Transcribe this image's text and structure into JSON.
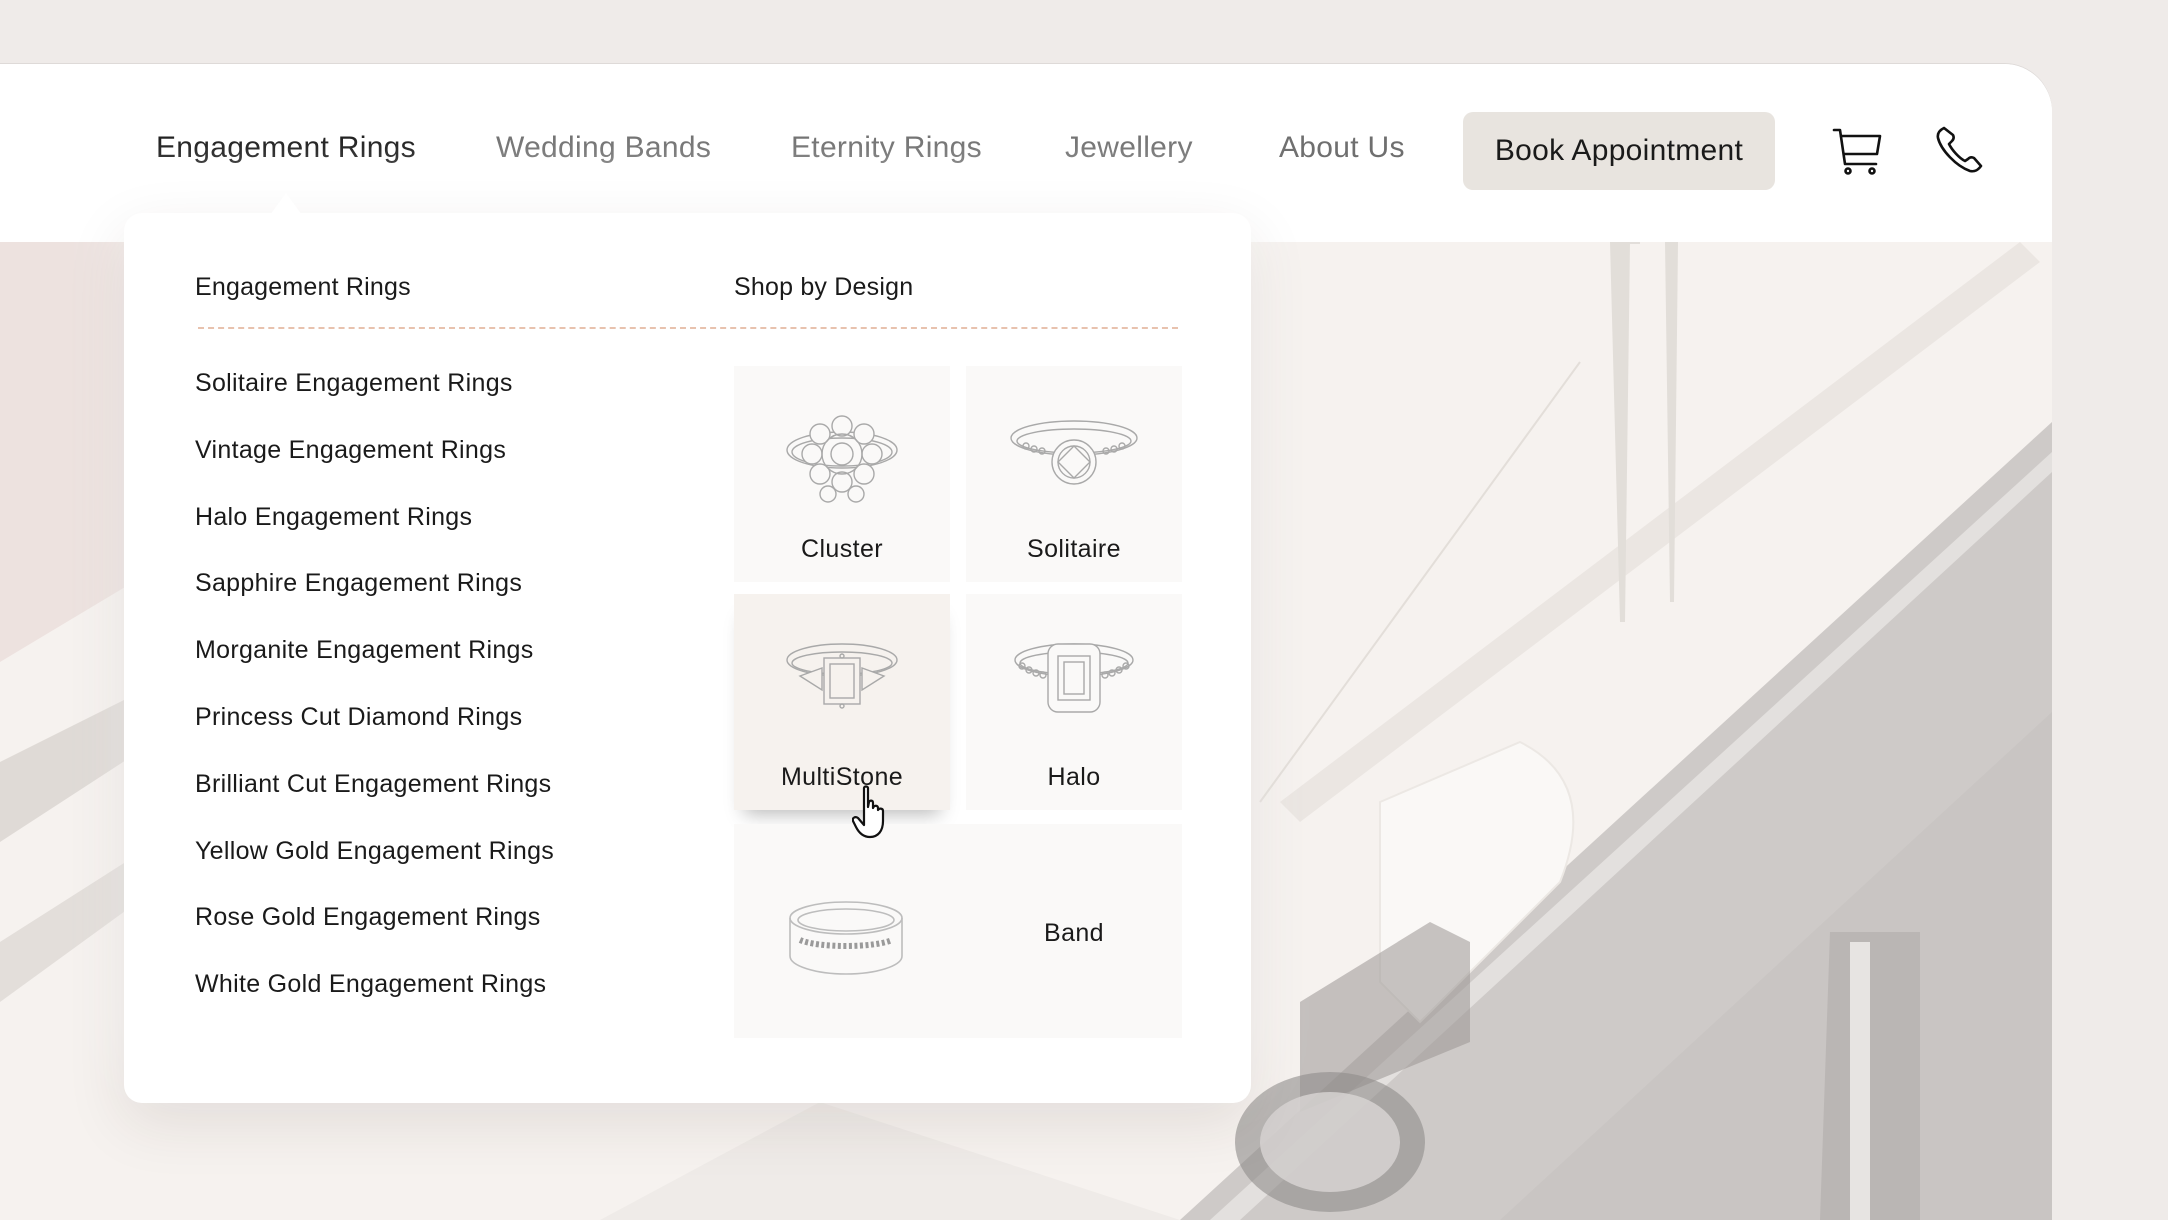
{
  "nav": {
    "items": [
      {
        "label": "Engagement Rings",
        "active": true
      },
      {
        "label": "Wedding Bands",
        "active": false
      },
      {
        "label": "Eternity Rings",
        "active": false
      },
      {
        "label": "Jewellery",
        "active": false
      },
      {
        "label": "About Us",
        "active": false
      }
    ],
    "book_button": "Book Appointment",
    "icons": [
      "cart-icon",
      "phone-icon"
    ]
  },
  "dropdown": {
    "list_heading": "Engagement Rings",
    "design_heading": "Shop by Design",
    "links": [
      "Solitaire Engagement Rings",
      "Vintage Engagement Rings",
      "Halo Engagement Rings",
      "Sapphire Engagement Rings",
      "Morganite Engagement Rings",
      "Princess Cut Diamond Rings",
      "Brilliant Cut Engagement Rings",
      "Yellow Gold Engagement Rings",
      "Rose Gold Engagement Rings",
      "White Gold Engagement Rings"
    ],
    "designs": [
      {
        "label": "Cluster",
        "icon": "cluster-ring-icon"
      },
      {
        "label": "Solitaire",
        "icon": "solitaire-ring-icon"
      },
      {
        "label": "MultiStone",
        "icon": "multistone-ring-icon",
        "hovered": true
      },
      {
        "label": "Halo",
        "icon": "halo-ring-icon"
      },
      {
        "label": "Band",
        "icon": "band-ring-icon"
      }
    ]
  },
  "colors": {
    "page_bg": "#efebe9",
    "button_bg": "#e8e4df",
    "divider": "#e8c2ae",
    "tile_bg": "#faf9f8",
    "tile_hover_bg": "#f6f2ee",
    "text": "#1a1a1a",
    "nav_muted": "#6f6f6f"
  }
}
